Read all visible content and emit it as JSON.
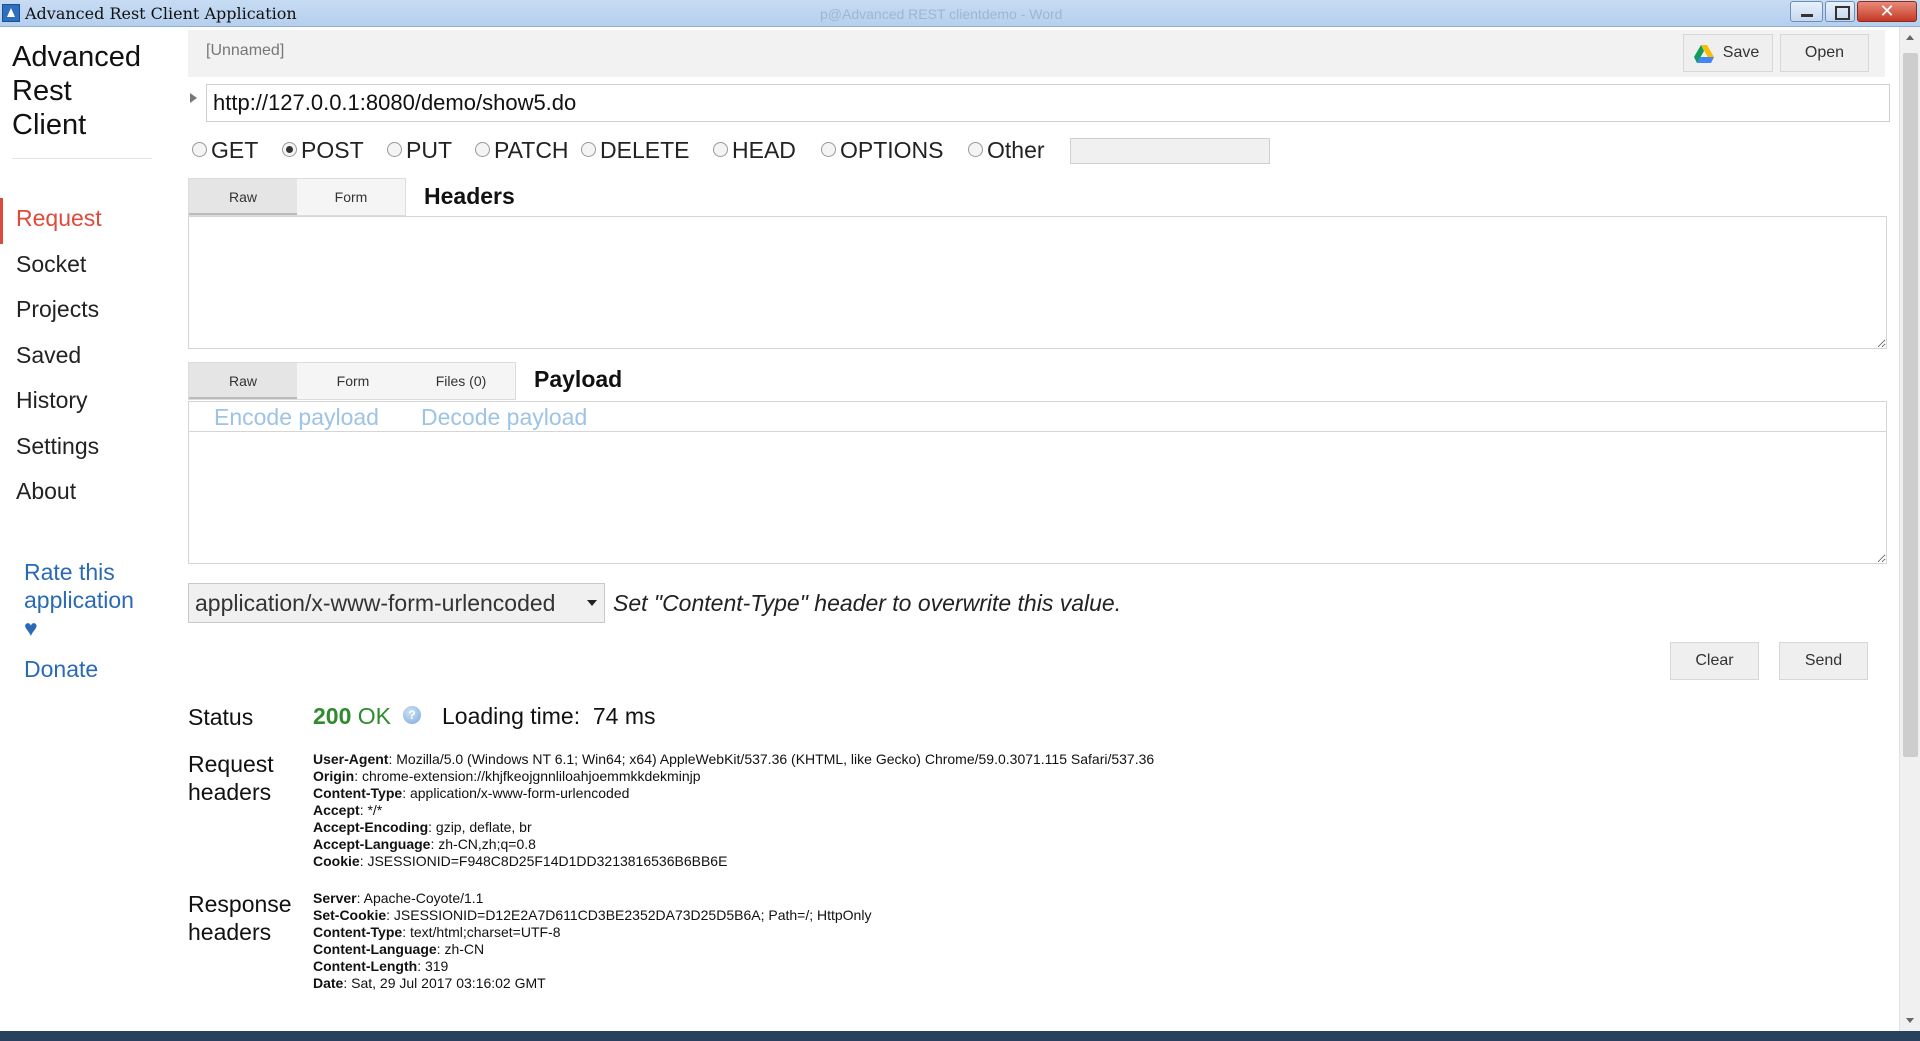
{
  "window": {
    "title": "Advanced Rest Client Application",
    "ghost_title": "p@Advanced REST clientdemo - Word"
  },
  "brand": {
    "line1": "Advanced",
    "line2": "Rest",
    "line3": "Client"
  },
  "nav": {
    "items": [
      {
        "label": "Request",
        "active": true
      },
      {
        "label": "Socket"
      },
      {
        "label": "Projects"
      },
      {
        "label": "Saved"
      },
      {
        "label": "History"
      },
      {
        "label": "Settings"
      },
      {
        "label": "About"
      }
    ],
    "rate_line1": "Rate this",
    "rate_line2": "application",
    "rate_heart": "♥",
    "donate": "Donate"
  },
  "topbar": {
    "name": "[Unnamed]",
    "save_label": "Save",
    "open_label": "Open"
  },
  "request": {
    "url": "http://127.0.0.1:8080/demo/show5.do",
    "methods": [
      "GET",
      "POST",
      "PUT",
      "PATCH",
      "DELETE",
      "HEAD",
      "OPTIONS",
      "Other"
    ],
    "selected_method": "POST"
  },
  "headers_section": {
    "title": "Headers",
    "tab_raw": "Raw",
    "tab_form": "Form",
    "value": ""
  },
  "payload_section": {
    "title": "Payload",
    "tab_raw": "Raw",
    "tab_form": "Form",
    "tab_files": "Files (0)",
    "encode": "Encode payload",
    "decode": "Decode payload",
    "value": ""
  },
  "content_type": {
    "value": "application/x-www-form-urlencoded",
    "hint": "Set \"Content-Type\" header to overwrite this value."
  },
  "actions": {
    "clear": "Clear",
    "send": "Send"
  },
  "response": {
    "status_label": "Status",
    "status_code": "200",
    "status_text": "OK",
    "loading_label": "Loading time:",
    "loading_value": "74 ms",
    "request_headers_label_1": "Request",
    "request_headers_label_2": "headers",
    "response_headers_label_1": "Response",
    "response_headers_label_2": "headers",
    "request_headers": [
      {
        "key": "User-Agent",
        "value": "Mozilla/5.0 (Windows NT 6.1; Win64; x64) AppleWebKit/537.36 (KHTML, like Gecko) Chrome/59.0.3071.115 Safari/537.36"
      },
      {
        "key": "Origin",
        "value": "chrome-extension://khjfkeojgnnliloahjoemmkkdekminjp"
      },
      {
        "key": "Content-Type",
        "value": "application/x-www-form-urlencoded"
      },
      {
        "key": "Accept",
        "value": "*/*"
      },
      {
        "key": "Accept-Encoding",
        "value": "gzip, deflate, br"
      },
      {
        "key": "Accept-Language",
        "value": "zh-CN,zh;q=0.8"
      },
      {
        "key": "Cookie",
        "value": "JSESSIONID=F948C8D25F14D1DD3213816536B6BB6E"
      }
    ],
    "response_headers": [
      {
        "key": "Server",
        "value": "Apache-Coyote/1.1"
      },
      {
        "key": "Set-Cookie",
        "value": "JSESSIONID=D12E2A7D611CD3BE2352DA73D25D5B6A; Path=/; HttpOnly"
      },
      {
        "key": "Content-Type",
        "value": "text/html;charset=UTF-8"
      },
      {
        "key": "Content-Language",
        "value": "zh-CN"
      },
      {
        "key": "Content-Length",
        "value": "319"
      },
      {
        "key": "Date",
        "value": "Sat, 29 Jul 2017 03:16:02 GMT"
      }
    ]
  }
}
